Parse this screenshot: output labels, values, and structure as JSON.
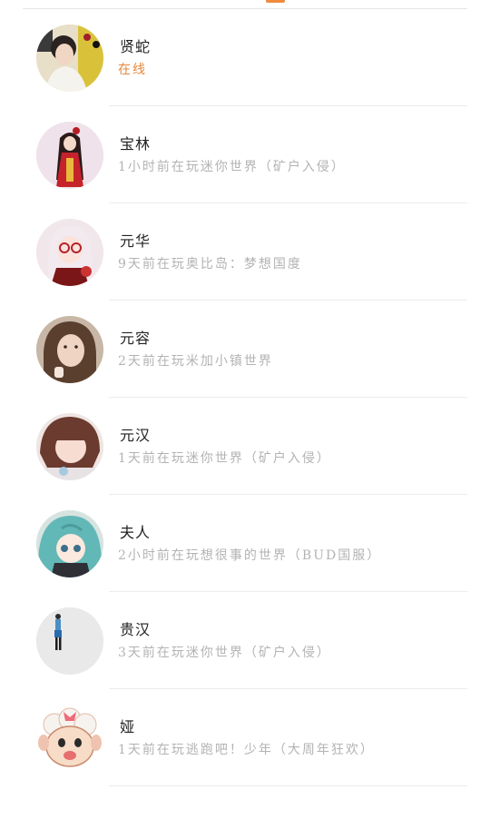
{
  "friends": [
    {
      "name": "贤蛇",
      "status": "在线",
      "online": true
    },
    {
      "name": "宝林",
      "status": "1小时前在玩迷你世界（矿户入侵）",
      "online": false
    },
    {
      "name": "元华",
      "status": "9天前在玩奥比岛：梦想国度",
      "online": false
    },
    {
      "name": "元容",
      "status": "2天前在玩米加小镇世界",
      "online": false
    },
    {
      "name": "元汉",
      "status": "1天前在玩迷你世界（矿户入侵）",
      "online": false
    },
    {
      "name": "夫人",
      "status": "2小时前在玩想很事的世界（BUD国服）",
      "online": false
    },
    {
      "name": "贵汉",
      "status": "3天前在玩迷你世界（矿户入侵）",
      "online": false
    },
    {
      "name": "娅",
      "status": "1天前在玩逃跑吧！少年（大周年狂欢）",
      "online": false
    }
  ],
  "colors": {
    "accent": "#f08a3e",
    "online": "#e7873a",
    "status": "#b3b3b3",
    "name": "#222222",
    "divider": "#ececec"
  }
}
